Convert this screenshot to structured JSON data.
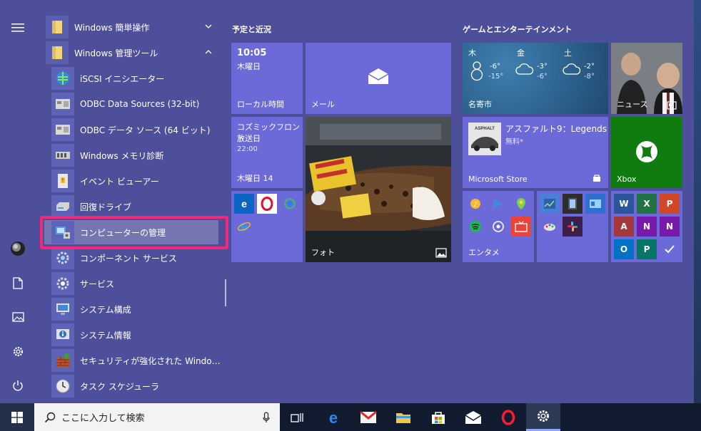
{
  "start_menu": {
    "app_list": [
      {
        "label": "Windows 簡単操作",
        "type": "folder",
        "expanded": false
      },
      {
        "label": "Windows 管理ツール",
        "type": "folder",
        "expanded": true
      },
      {
        "label": "iSCSI イニシエーター",
        "type": "app",
        "icon": "globe-icon"
      },
      {
        "label": "ODBC Data Sources (32-bit)",
        "type": "app",
        "icon": "odbc-icon"
      },
      {
        "label": "ODBC データ ソース (64 ビット)",
        "type": "app",
        "icon": "odbc-icon"
      },
      {
        "label": "Windows メモリ診断",
        "type": "app",
        "icon": "memory-chip-icon"
      },
      {
        "label": "イベント ビューアー",
        "type": "app",
        "icon": "event-viewer-icon"
      },
      {
        "label": "回復ドライブ",
        "type": "app",
        "icon": "drive-icon"
      },
      {
        "label": "コンピューターの管理",
        "type": "app",
        "icon": "computer-management-icon",
        "selected": true
      },
      {
        "label": "コンポーネント サービス",
        "type": "app",
        "icon": "gear-icon"
      },
      {
        "label": "サービス",
        "type": "app",
        "icon": "gear-icon"
      },
      {
        "label": "システム構成",
        "type": "app",
        "icon": "monitor-icon"
      },
      {
        "label": "システム情報",
        "type": "app",
        "icon": "info-icon"
      },
      {
        "label": "セキュリティが強化された Windows De...",
        "type": "app",
        "icon": "firewall-icon"
      },
      {
        "label": "タスク スケジューラ",
        "type": "app",
        "icon": "clock-icon"
      }
    ],
    "groups": {
      "left": "予定と近況",
      "right": "ゲームとエンターテインメント"
    },
    "tiles": {
      "clock": {
        "time": "10:05",
        "day": "木曜日",
        "name": "ローカル時間"
      },
      "mail": {
        "name": "メール"
      },
      "broadcast": {
        "line1": "コズミックフロント",
        "line2": "放送日",
        "time": "22:00",
        "date": "木曜日 14"
      },
      "photos": {
        "name": "フォト"
      },
      "weather": {
        "days": [
          {
            "day": "木",
            "high": "-6°",
            "low": "-15°"
          },
          {
            "day": "金",
            "high": "-3°",
            "low": "-6°"
          },
          {
            "day": "土",
            "high": "-2°",
            "low": "-8°"
          }
        ],
        "city": "名寄市"
      },
      "news": {
        "name": "ニュース"
      },
      "store": {
        "title": "アスファルト9：Legends",
        "price": "無料*",
        "name": "Microsoft Store",
        "logo_text": "ASPHALT"
      },
      "xbox": {
        "name": "Xbox"
      },
      "enta": {
        "name": "エンタメ"
      }
    }
  },
  "taskbar": {
    "search_placeholder": "ここに入力して検索"
  },
  "colors": {
    "start_bg": "#4e4f9b",
    "tile": "#6b6ad8",
    "highlight": "#f3287a",
    "xbox": "#107c10"
  }
}
